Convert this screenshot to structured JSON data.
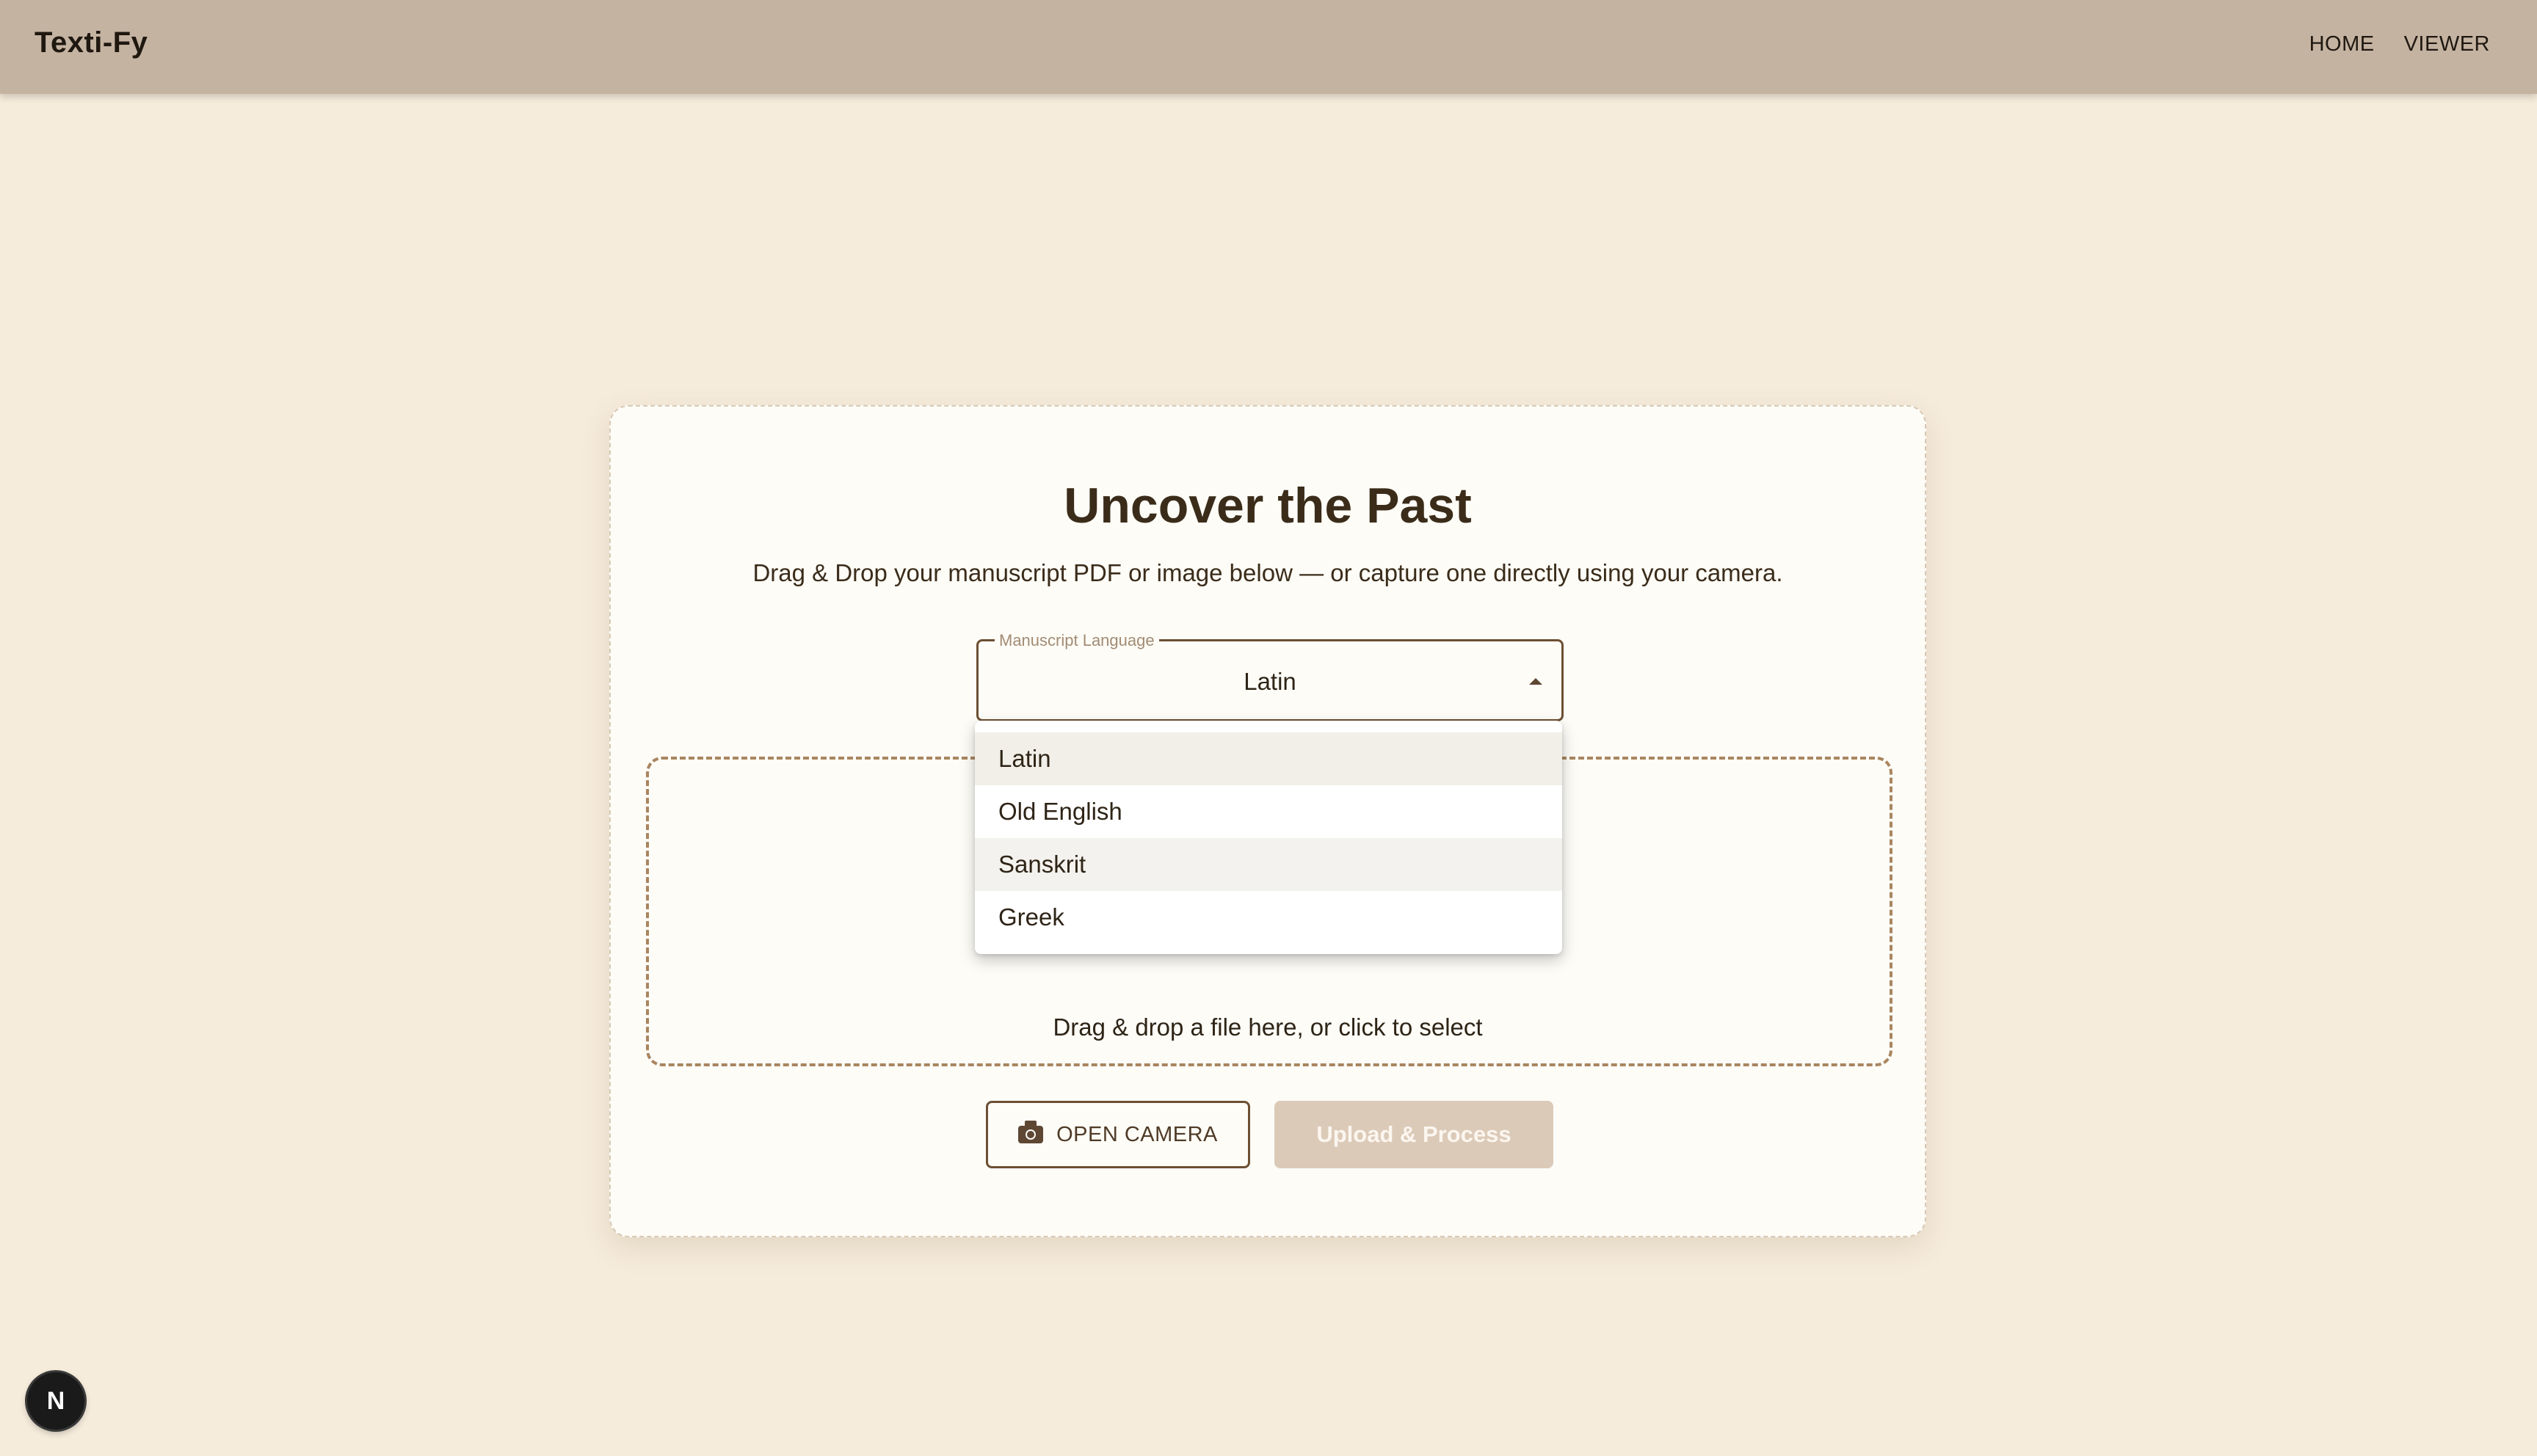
{
  "header": {
    "brand": "Texti-Fy",
    "nav": [
      "HOME",
      "VIEWER"
    ]
  },
  "hero": {
    "title": "Uncover the Past",
    "subtitle": "Drag & Drop your manuscript PDF or image below — or capture one directly using your camera."
  },
  "language_select": {
    "label": "Manuscript Language",
    "value": "Latin",
    "options": [
      "Latin",
      "Old English",
      "Sanskrit",
      "Greek"
    ]
  },
  "dropzone": {
    "text": "Drag & drop a file here, or click to select"
  },
  "actions": {
    "camera_label": "OPEN CAMERA",
    "upload_label": "Upload & Process"
  },
  "badge": {
    "letter": "N"
  },
  "colors": {
    "background": "#f6ecdc",
    "appbar": "#c5b3a2",
    "card": "#fdfcf7",
    "accent_brown": "#6d4f33",
    "disabled_button": "#dccab8"
  },
  "icons": {
    "camera_button": "camera-icon",
    "select_arrow": "arrow-drop-up-icon"
  }
}
